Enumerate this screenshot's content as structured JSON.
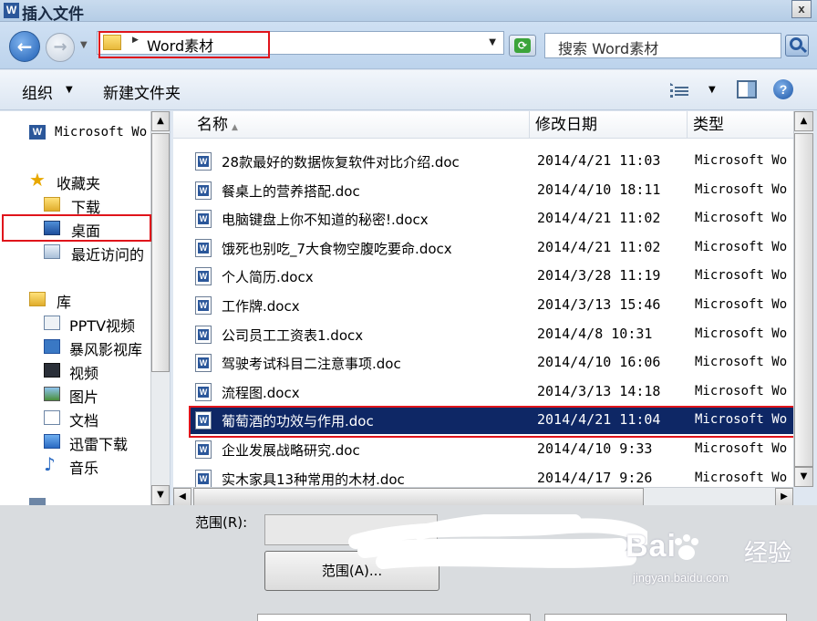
{
  "window": {
    "title": "插入文件",
    "close_label": "x"
  },
  "address": {
    "path": "Word素材",
    "search_placeholder": "搜索 Word素材"
  },
  "toolbar": {
    "organize_label": "组织",
    "new_folder_label": "新建文件夹"
  },
  "nav": {
    "items": [
      {
        "label": "Microsoft Wo",
        "icon": "word-icon"
      },
      {
        "label": "收藏夹",
        "icon": "star-icon"
      },
      {
        "label": "下载",
        "icon": "downloads-folder-icon"
      },
      {
        "label": "桌面",
        "icon": "desktop-icon"
      },
      {
        "label": "最近访问的",
        "icon": "recent-places-icon"
      },
      {
        "label": "库",
        "icon": "library-icon"
      },
      {
        "label": "PPTV视频",
        "icon": "video-library-icon"
      },
      {
        "label": "暴风影视库",
        "icon": "video-library-icon"
      },
      {
        "label": "视频",
        "icon": "video-icon"
      },
      {
        "label": "图片",
        "icon": "pictures-icon"
      },
      {
        "label": "文档",
        "icon": "documents-icon"
      },
      {
        "label": "迅雷下载",
        "icon": "downloads-icon"
      },
      {
        "label": "音乐",
        "icon": "music-icon"
      }
    ]
  },
  "columns": {
    "name": "名称",
    "date": "修改日期",
    "type": "类型"
  },
  "files": [
    {
      "name": "28款最好的数据恢复软件对比介绍.doc",
      "date": "2014/4/21 11:03",
      "type": "Microsoft Wo"
    },
    {
      "name": "餐桌上的营养搭配.doc",
      "date": "2014/4/10 18:11",
      "type": "Microsoft Wo"
    },
    {
      "name": "电脑键盘上你不知道的秘密!.docx",
      "date": "2014/4/21 11:02",
      "type": "Microsoft Wo"
    },
    {
      "name": "饿死也别吃_7大食物空腹吃要命.docx",
      "date": "2014/4/21 11:02",
      "type": "Microsoft Wo"
    },
    {
      "name": "个人简历.docx",
      "date": "2014/3/28 11:19",
      "type": "Microsoft Wo"
    },
    {
      "name": "工作牌.docx",
      "date": "2014/3/13 15:46",
      "type": "Microsoft Wo"
    },
    {
      "name": "公司员工工资表1.docx",
      "date": "2014/4/8 10:31",
      "type": "Microsoft Wo"
    },
    {
      "name": "驾驶考试科目二注意事项.doc",
      "date": "2014/4/10 16:06",
      "type": "Microsoft Wo"
    },
    {
      "name": "流程图.docx",
      "date": "2014/3/13 14:18",
      "type": "Microsoft Wo"
    },
    {
      "name": "葡萄酒的功效与作用.doc",
      "date": "2014/4/21 11:04",
      "type": "Microsoft Wo",
      "selected": true
    },
    {
      "name": "企业发展战略研究.doc",
      "date": "2014/4/10 9:33",
      "type": "Microsoft Wo"
    },
    {
      "name": "实木家具13种常用的木材.doc",
      "date": "2014/4/17 9:26",
      "type": "Microsoft Wo"
    }
  ],
  "bottom": {
    "range_label": "范围(R):",
    "range_button": "范围(A)..."
  },
  "watermark": {
    "logo": "Bai",
    "text": "经验",
    "url": "jingyan.baidu.com"
  },
  "colors": {
    "highlight_red": "#e0141b",
    "selection_blue": "#0e2765"
  }
}
